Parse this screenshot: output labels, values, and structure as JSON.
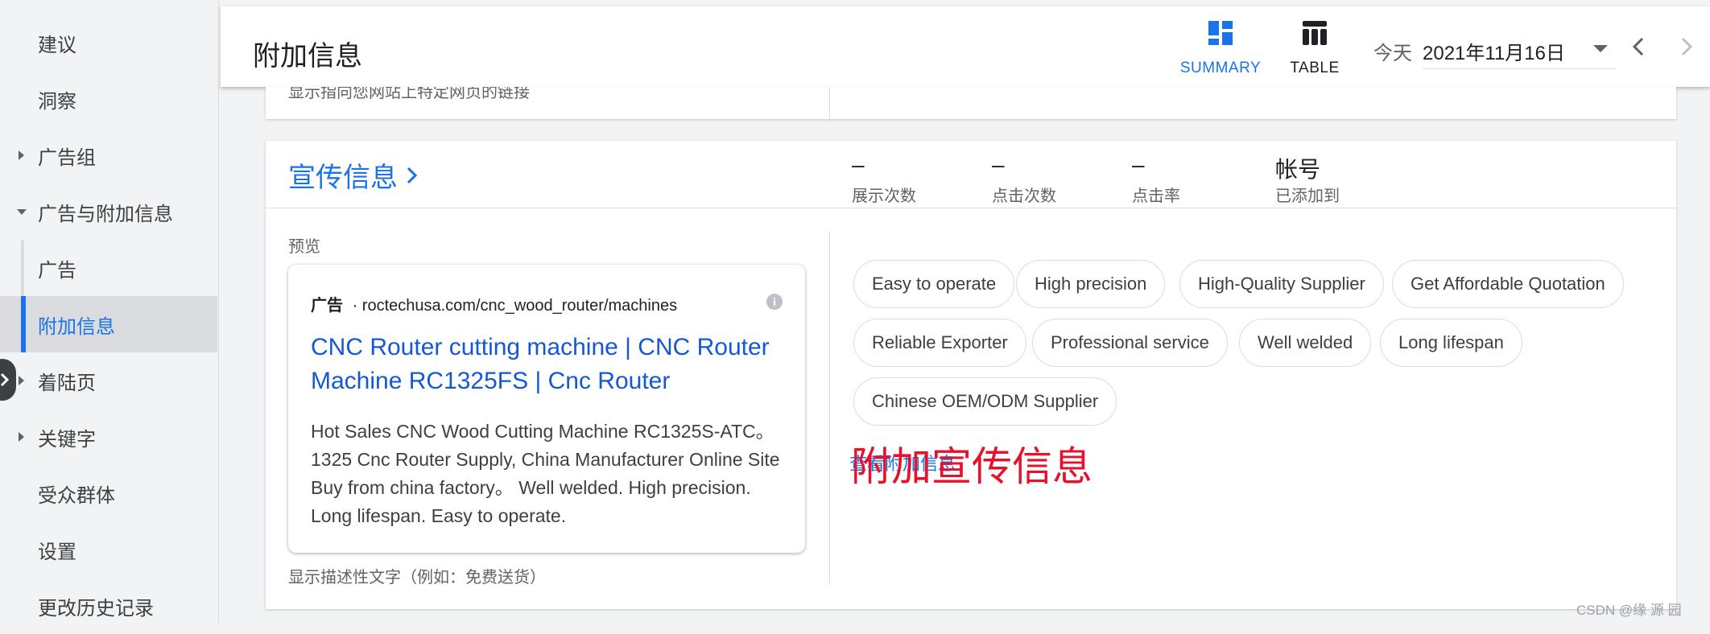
{
  "sidebar": {
    "items": [
      {
        "label": "建议"
      },
      {
        "label": "洞察"
      },
      {
        "label": "广告组"
      },
      {
        "label": "广告与附加信息"
      },
      {
        "label": "广告"
      },
      {
        "label": "附加信息"
      },
      {
        "label": "着陆页"
      },
      {
        "label": "关键字"
      },
      {
        "label": "受众群体"
      },
      {
        "label": "设置"
      },
      {
        "label": "更改历史记录"
      }
    ]
  },
  "header": {
    "title": "附加信息",
    "summary_label": "SUMMARY",
    "table_label": "TABLE",
    "today_label": "今天",
    "date_value": "2021年11月16日"
  },
  "top_card": {
    "cut_text": "显示指向您网站上特定网页的链接"
  },
  "card": {
    "title": "宣传信息",
    "metrics": [
      {
        "value": "–",
        "label": "展示次数"
      },
      {
        "value": "–",
        "label": "点击次数"
      },
      {
        "value": "–",
        "label": "点击率"
      },
      {
        "value": "帐号",
        "label": "已添加到"
      }
    ],
    "preview_label": "预览",
    "ad": {
      "badge": "广告",
      "url": "roctechusa.com/cnc_wood_router/machines",
      "info_icon": "i",
      "headline": "CNC Router cutting machine | CNC Router Machine RC1325FS | Cnc Router",
      "description": "Hot Sales CNC Wood Cutting Machine RC1325S-ATC。 1325 Cnc Router Supply, China Manufacturer Online Site Buy from china factory。 Well welded. High precision. Long lifespan. Easy to operate."
    },
    "description_hint": "显示描述性文字（例如：免费送货）",
    "chips": [
      "Easy to operate",
      "High precision",
      "High-Quality Supplier",
      "Get Affordable Quotation",
      "Reliable Exporter",
      "Professional service",
      "Well welded",
      "Long lifespan",
      "Chinese OEM/ODM Supplier"
    ],
    "view_link": "查看附加信息",
    "annotation": "附加宣传信息"
  },
  "watermark": "CSDN @缘 源 园",
  "colors": {
    "accent": "#1a73e8",
    "annotation": "#e8102a"
  }
}
